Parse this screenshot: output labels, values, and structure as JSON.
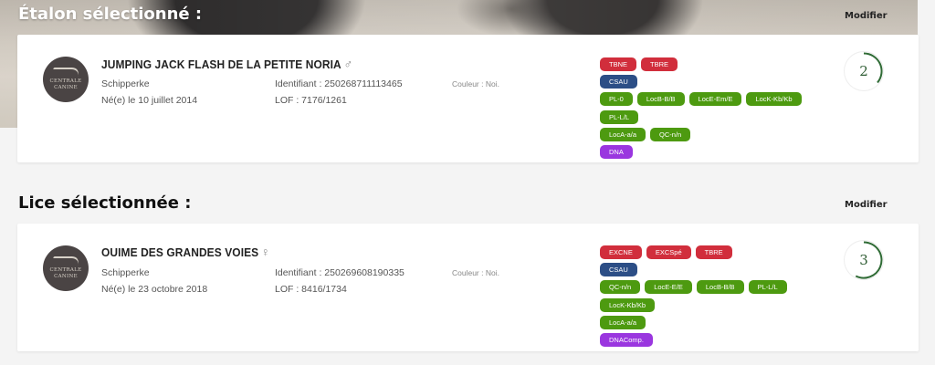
{
  "stallion": {
    "section_title": "Étalon sélectionné :",
    "modify_label": "Modifier",
    "avatar_text": [
      "Centrale",
      "Canine"
    ],
    "name": "JUMPING JACK FLASH DE LA PETITE NORIA",
    "sex_icon": "♂",
    "breed": "Schipperke",
    "birth": "Né(e) le 10 juillet 2014",
    "identifier": "Identifiant : 250268711113465",
    "lof": "LOF : 7176/1261",
    "color": "Couleur : Noi.",
    "score": "2",
    "badge_rows": [
      [
        {
          "label": "TBNE",
          "color": "red"
        },
        {
          "label": "TBRE",
          "color": "red"
        }
      ],
      [
        {
          "label": "CSAU",
          "color": "blue"
        }
      ],
      [
        {
          "label": "PL-0",
          "color": "green"
        },
        {
          "label": "LocB-B/B",
          "color": "green"
        },
        {
          "label": "LocE-Em/E",
          "color": "green"
        },
        {
          "label": "LocK-Kb/Kb",
          "color": "green"
        },
        {
          "label": "PL-L/L",
          "color": "green"
        }
      ],
      [
        {
          "label": "LocA-a/a",
          "color": "green"
        },
        {
          "label": "QC-n/n",
          "color": "green"
        }
      ],
      [
        {
          "label": "DNA",
          "color": "purple"
        }
      ]
    ]
  },
  "mare": {
    "section_title": "Lice sélectionnée :",
    "modify_label": "Modifier",
    "avatar_text": [
      "Centrale",
      "Canine"
    ],
    "name": "OUIME DES GRANDES VOIES",
    "sex_icon": "♀",
    "breed": "Schipperke",
    "birth": "Né(e) le 23 octobre 2018",
    "identifier": "Identifiant : 250269608190335",
    "lof": "LOF : 8416/1734",
    "color": "Couleur : Noi.",
    "score": "3",
    "badge_rows": [
      [
        {
          "label": "EXCNE",
          "color": "red"
        },
        {
          "label": "EXCSpé",
          "color": "red"
        },
        {
          "label": "TBRE",
          "color": "red"
        }
      ],
      [
        {
          "label": "CSAU",
          "color": "blue"
        }
      ],
      [
        {
          "label": "QC-n/n",
          "color": "green"
        },
        {
          "label": "LocE-E/E",
          "color": "green"
        },
        {
          "label": "LocB-B/B",
          "color": "green"
        },
        {
          "label": "PL-L/L",
          "color": "green"
        },
        {
          "label": "LocK-Kb/Kb",
          "color": "green"
        }
      ],
      [
        {
          "label": "LocA-a/a",
          "color": "green"
        }
      ],
      [
        {
          "label": "DNAComp.",
          "color": "purple"
        }
      ]
    ]
  }
}
